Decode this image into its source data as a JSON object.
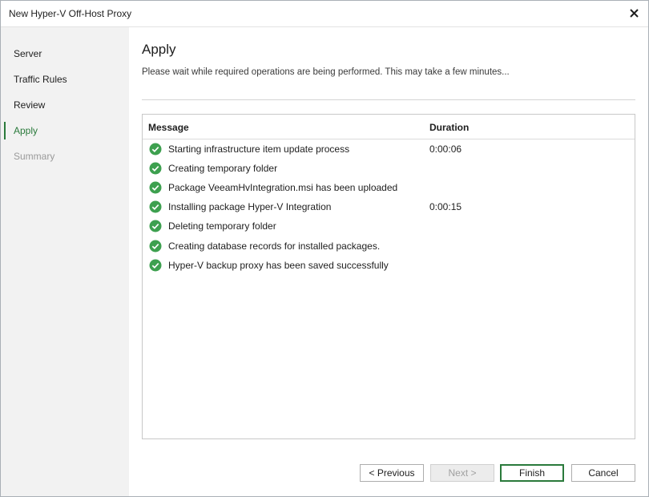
{
  "window": {
    "title": "New Hyper-V Off-Host Proxy"
  },
  "sidebar": {
    "steps": [
      {
        "label": "Server",
        "state": "done"
      },
      {
        "label": "Traffic Rules",
        "state": "done"
      },
      {
        "label": "Review",
        "state": "done"
      },
      {
        "label": "Apply",
        "state": "active"
      },
      {
        "label": "Summary",
        "state": "disabled"
      }
    ]
  },
  "page": {
    "heading": "Apply",
    "subtitle": "Please wait while required operations are being performed. This may take a few minutes..."
  },
  "table": {
    "columns": {
      "message": "Message",
      "duration": "Duration"
    },
    "rows": [
      {
        "message": "Starting infrastructure item update process",
        "duration": "0:00:06",
        "status": "success"
      },
      {
        "message": "Creating temporary folder",
        "duration": "",
        "status": "success"
      },
      {
        "message": "Package VeeamHvIntegration.msi has been uploaded",
        "duration": "",
        "status": "success"
      },
      {
        "message": "Installing package Hyper-V Integration",
        "duration": "0:00:15",
        "status": "success"
      },
      {
        "message": "Deleting temporary folder",
        "duration": "",
        "status": "success"
      },
      {
        "message": "Creating database records for installed packages.",
        "duration": "",
        "status": "success"
      },
      {
        "message": "Hyper-V backup proxy has been saved successfully",
        "duration": "",
        "status": "success"
      }
    ]
  },
  "buttons": {
    "previous": "< Previous",
    "next": "Next >",
    "finish": "Finish",
    "cancel": "Cancel"
  },
  "colors": {
    "accent": "#2a7a3b",
    "success": "#3da04f"
  },
  "icons": {
    "close": "close-icon",
    "status": "check-circle-icon"
  }
}
